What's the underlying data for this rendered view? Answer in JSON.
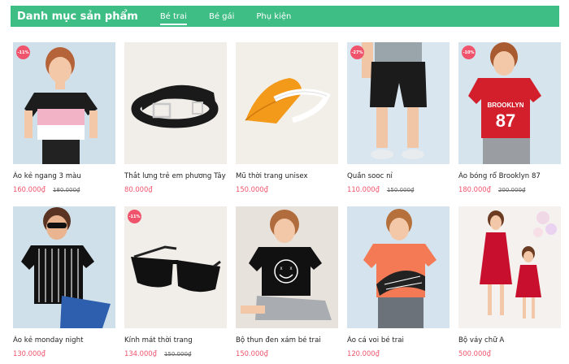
{
  "header": {
    "title": "Danh mục sản phẩm",
    "tabs": [
      {
        "label": "Bé trai",
        "active": true
      },
      {
        "label": "Bé gái",
        "active": false
      },
      {
        "label": "Phụ kiện",
        "active": false
      }
    ]
  },
  "products": [
    {
      "name": "Áo kẻ ngang 3 màu",
      "price": "160.000₫",
      "old_price": "180.000₫",
      "badge": "-11%",
      "image": "boy-tshirt-pink-black"
    },
    {
      "name": "Thắt lưng trẻ em phương Tây",
      "price": "80.000₫",
      "old_price": "",
      "badge": "",
      "image": "black-belt"
    },
    {
      "name": "Mũ thời trang unisex",
      "price": "150.000₫",
      "old_price": "",
      "badge": "",
      "image": "orange-visor-hat"
    },
    {
      "name": "Quần sooc nỉ",
      "price": "110.000₫",
      "old_price": "150.000₫",
      "badge": "-27%",
      "image": "boy-black-shorts"
    },
    {
      "name": "Áo bóng rổ Brooklyn 87",
      "price": "180.000₫",
      "old_price": "200.000₫",
      "badge": "-10%",
      "image": "boy-red-jersey"
    },
    {
      "name": "Áo kẻ monday night",
      "price": "130.000₫",
      "old_price": "",
      "badge": "",
      "image": "boy-striped-tshirt"
    },
    {
      "name": "Kính mát thời trang",
      "price": "134.000₫",
      "old_price": "150.000₫",
      "badge": "-11%",
      "image": "black-sunglasses"
    },
    {
      "name": "Bộ thun đen xám bé trai",
      "price": "150.000₫",
      "old_price": "",
      "badge": "",
      "image": "boy-black-smiley-tee"
    },
    {
      "name": "Áo cá voi bé trai",
      "price": "120.000₫",
      "old_price": "",
      "badge": "",
      "image": "boy-whale-tee"
    },
    {
      "name": "Bộ váy chữ A",
      "price": "500.000₫",
      "old_price": "",
      "badge": "",
      "image": "girls-red-dresses"
    }
  ]
}
